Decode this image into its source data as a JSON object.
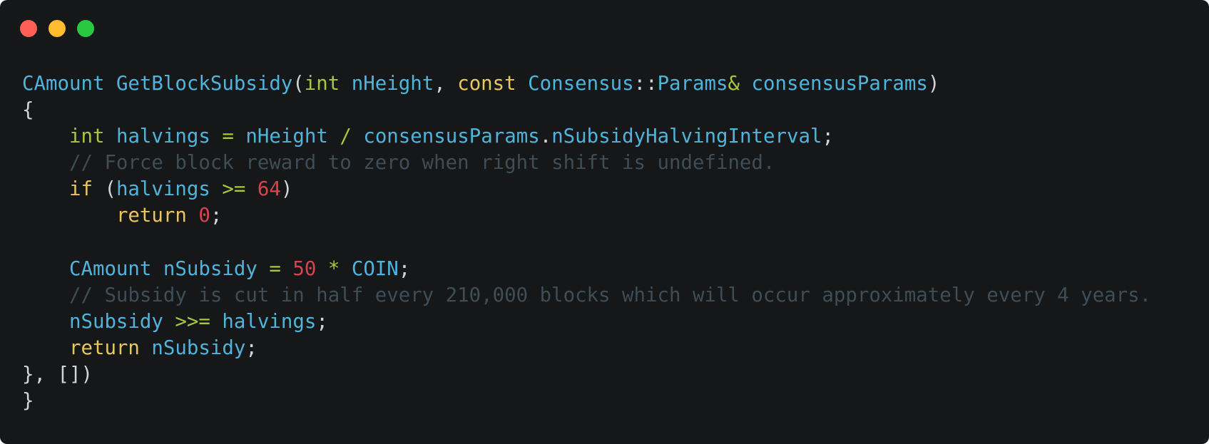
{
  "window": {
    "controls": [
      {
        "name": "close-button",
        "color": "#ff5f57"
      },
      {
        "name": "minimize-button",
        "color": "#febc2e"
      },
      {
        "name": "maximize-button",
        "color": "#28c840"
      }
    ]
  },
  "code": {
    "lines": [
      [
        [
          "CAmount",
          "id"
        ],
        [
          " ",
          "pun"
        ],
        [
          "GetBlockSubsidy",
          "id"
        ],
        [
          "(",
          "pun"
        ],
        [
          "int",
          "type"
        ],
        [
          " ",
          "pun"
        ],
        [
          "nHeight",
          "id"
        ],
        [
          ", ",
          "pun"
        ],
        [
          "const",
          "kw"
        ],
        [
          " ",
          "pun"
        ],
        [
          "Consensus",
          "id"
        ],
        [
          "::",
          "pun"
        ],
        [
          "Params",
          "id"
        ],
        [
          "&",
          "op"
        ],
        [
          " ",
          "pun"
        ],
        [
          "consensusParams",
          "id"
        ],
        [
          ")",
          "pun"
        ]
      ],
      [
        [
          "{",
          "pun"
        ]
      ],
      [
        [
          "    ",
          "pun"
        ],
        [
          "int",
          "type"
        ],
        [
          " ",
          "pun"
        ],
        [
          "halvings",
          "id"
        ],
        [
          " ",
          "pun"
        ],
        [
          "=",
          "op"
        ],
        [
          " ",
          "pun"
        ],
        [
          "nHeight",
          "id"
        ],
        [
          " ",
          "pun"
        ],
        [
          "/",
          "op"
        ],
        [
          " ",
          "pun"
        ],
        [
          "consensusParams",
          "id"
        ],
        [
          ".",
          "pun"
        ],
        [
          "nSubsidyHalvingInterval",
          "id"
        ],
        [
          ";",
          "pun"
        ]
      ],
      [
        [
          "    ",
          "pun"
        ],
        [
          "// Force block reward to zero when right shift is undefined.",
          "com"
        ]
      ],
      [
        [
          "    ",
          "pun"
        ],
        [
          "if",
          "kw"
        ],
        [
          " (",
          "pun"
        ],
        [
          "halvings",
          "id"
        ],
        [
          " ",
          "pun"
        ],
        [
          ">=",
          "op"
        ],
        [
          " ",
          "pun"
        ],
        [
          "64",
          "num"
        ],
        [
          ")",
          "pun"
        ]
      ],
      [
        [
          "        ",
          "pun"
        ],
        [
          "return",
          "kw"
        ],
        [
          " ",
          "pun"
        ],
        [
          "0",
          "num"
        ],
        [
          ";",
          "pun"
        ]
      ],
      [],
      [
        [
          "    ",
          "pun"
        ],
        [
          "CAmount",
          "id"
        ],
        [
          " ",
          "pun"
        ],
        [
          "nSubsidy",
          "id"
        ],
        [
          " ",
          "pun"
        ],
        [
          "=",
          "op"
        ],
        [
          " ",
          "pun"
        ],
        [
          "50",
          "num"
        ],
        [
          " ",
          "pun"
        ],
        [
          "*",
          "op"
        ],
        [
          " ",
          "pun"
        ],
        [
          "COIN",
          "id"
        ],
        [
          ";",
          "pun"
        ]
      ],
      [
        [
          "    ",
          "pun"
        ],
        [
          "// Subsidy is cut in half every 210,000 blocks which will occur approximately every 4 years.",
          "com"
        ]
      ],
      [
        [
          "    ",
          "pun"
        ],
        [
          "nSubsidy",
          "id"
        ],
        [
          " ",
          "pun"
        ],
        [
          ">>=",
          "op"
        ],
        [
          " ",
          "pun"
        ],
        [
          "halvings",
          "id"
        ],
        [
          ";",
          "pun"
        ]
      ],
      [
        [
          "    ",
          "pun"
        ],
        [
          "return",
          "kw"
        ],
        [
          " ",
          "pun"
        ],
        [
          "nSubsidy",
          "id"
        ],
        [
          ";",
          "pun"
        ]
      ],
      [
        [
          "}, [])",
          "pun"
        ]
      ],
      [
        [
          "}",
          "pun"
        ]
      ]
    ]
  }
}
